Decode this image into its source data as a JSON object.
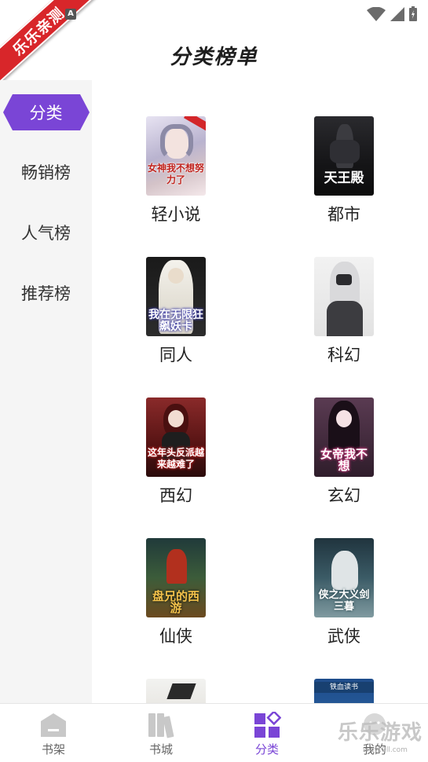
{
  "status_bar": {
    "watermark_badge": "乐乐亲测",
    "notification_icon": "A"
  },
  "header": {
    "title": "分类榜单"
  },
  "sidebar": {
    "items": [
      {
        "label": "分类",
        "active": true
      },
      {
        "label": "畅销榜",
        "active": false
      },
      {
        "label": "人气榜",
        "active": false
      },
      {
        "label": "推荐榜",
        "active": false
      }
    ]
  },
  "categories": [
    {
      "label": "轻小说",
      "cover_text": "女神我不想努力了"
    },
    {
      "label": "都市",
      "cover_text": "天王殿"
    },
    {
      "label": "同人",
      "cover_text": "我在无限狂飙妖卡"
    },
    {
      "label": "科幻",
      "cover_text": ""
    },
    {
      "label": "西幻",
      "cover_text": "这年头反派越来越难了"
    },
    {
      "label": "玄幻",
      "cover_text": "女帝我不想"
    },
    {
      "label": "仙侠",
      "cover_text": "盘兄的西游"
    },
    {
      "label": "武侠",
      "cover_text": "侠之大义剑三暮"
    },
    {
      "label": "",
      "cover_text": ""
    },
    {
      "label": "",
      "cover_text": "铁血读书"
    }
  ],
  "bottom_nav": {
    "items": [
      {
        "label": "书架",
        "icon": "bookshelf-icon",
        "active": false
      },
      {
        "label": "书城",
        "icon": "bookstore-icon",
        "active": false
      },
      {
        "label": "分类",
        "icon": "category-icon",
        "active": true
      },
      {
        "label": "我的",
        "icon": "profile-icon",
        "active": false
      }
    ]
  },
  "site_watermark": {
    "name": "乐乐游戏",
    "url": "www.9ll.com"
  },
  "colors": {
    "accent": "#7a45d6",
    "sidebar_bg": "#f5f5f5",
    "inactive_icon": "#c8c8c8"
  }
}
